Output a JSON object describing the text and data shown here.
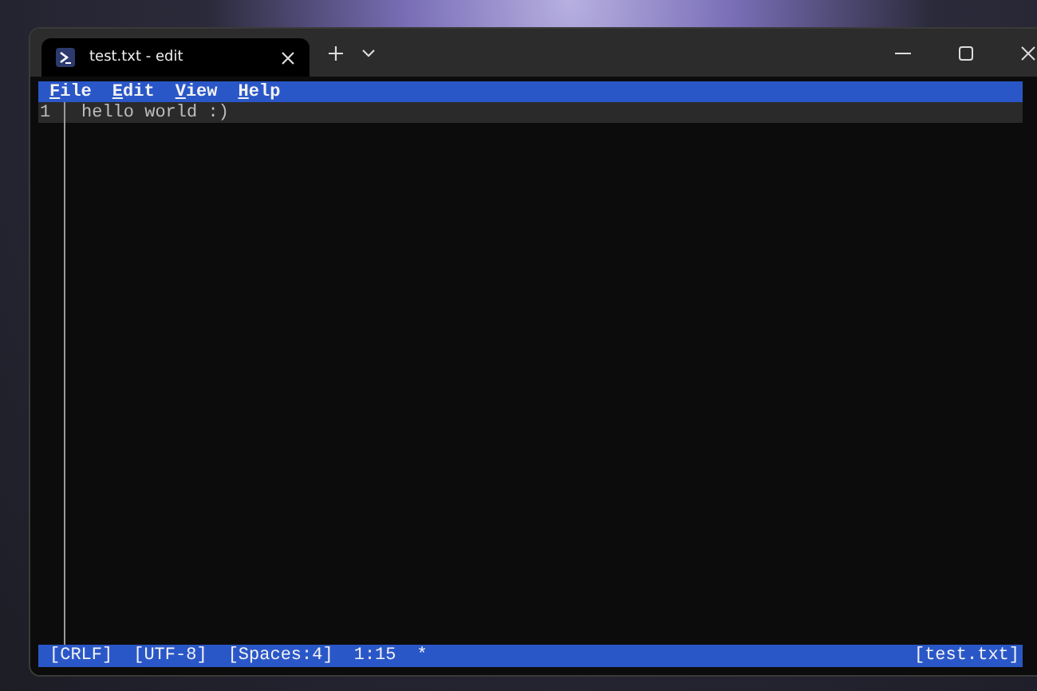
{
  "tab": {
    "title": "test.txt - edit",
    "selected": true
  },
  "menu": [
    {
      "label": "File"
    },
    {
      "label": "Edit"
    },
    {
      "label": "View"
    },
    {
      "label": "Help"
    }
  ],
  "lines": [
    {
      "number": "1",
      "text": "hello world :)",
      "current": true
    }
  ],
  "status_bar": {
    "left": [
      "[CRLF]",
      "[UTF-8]",
      "[Spaces:4]",
      "1:15",
      "*"
    ],
    "right": "[test.txt]"
  }
}
